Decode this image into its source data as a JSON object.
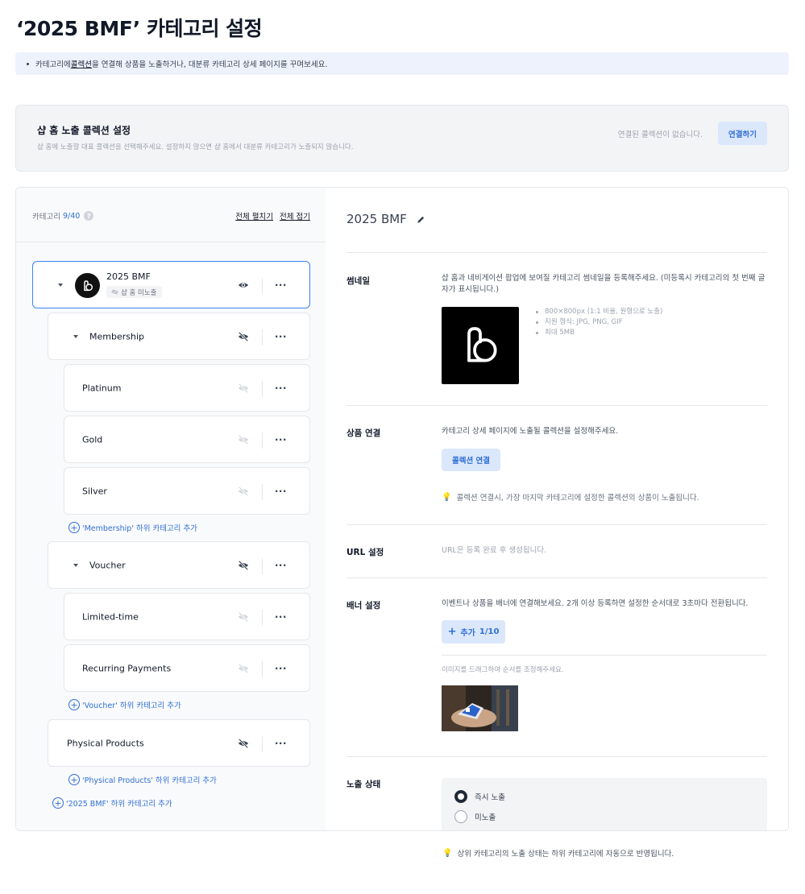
{
  "page": {
    "title": "‘2025 BMF’ 카테고리 설정"
  },
  "notice": {
    "text_before": "카테고리에 ",
    "link": "콜렉션",
    "text_after": "을 연결해 상품을 노출하거나, 대분류 카테고리 상세 페이지를 꾸며보세요."
  },
  "shop_home": {
    "title": "샵 홈 노출 콜렉션 설정",
    "description": "샵 홈에 노출할 대표 콜렉션을 선택해주세요. 설정하지 않으면 샵 홈에서 대분류 카테고리가 노출되지 않습니다.",
    "status": "연결된 콜렉션이 없습니다.",
    "connect_button": "연결하기"
  },
  "category_tree": {
    "label": "카테고리",
    "count": "9/40",
    "expand_all": "전체 펼치기",
    "collapse_all": "전체 접기",
    "root": {
      "name": "2025 BMF",
      "badge": "샵 홈 미노출"
    },
    "membership": {
      "name": "Membership",
      "children": [
        "Platinum",
        "Gold",
        "Silver"
      ],
      "add_label": "'Membership' 하위 카테고리 추가"
    },
    "voucher": {
      "name": "Voucher",
      "children": [
        "Limited-time",
        "Recurring Payments"
      ],
      "add_label": "'Voucher' 하위 카테고리 추가"
    },
    "physical": {
      "name": "Physical Products",
      "add_label": "'Physical Products' 하위 카테고리 추가"
    },
    "root_add_label": "'2025 BMF' 하위 카테고리 추가"
  },
  "detail": {
    "title": "2025 BMF",
    "thumbnail": {
      "label": "썸네일",
      "description_line1": "샵 홈과 네비게이션 팝업에 보여질 카테고리 썸네일을 등록해주세요. (미등록시 카테고리의 첫 번째 글",
      "description_line2": "자가 표시됩니다.)",
      "specs": [
        "800×800px (1:1 비율, 원형으로 노출)",
        "지원 형식: JPG, PNG, GIF",
        "최대 5MB"
      ]
    },
    "product_link": {
      "label": "상품 연결",
      "description": "카테고리 상세 페이지에 노출될 콜렉션을 설정해주세요.",
      "button": "콜렉션 연결",
      "hint": "콜렉션 연결시, 가장 마지막 카테고리에 설정한 콜렉션의 상품이 노출됩니다."
    },
    "url": {
      "label": "URL 설정",
      "text": "URL은 등록 완료 후 생성됩니다."
    },
    "banner": {
      "label": "배너 설정",
      "description": "이벤트나 상품을 배너에 연결해보세요. 2개 이상 등록하면 설정한 순서대로 3초마다 전환됩니다.",
      "add_button": "추가",
      "add_count": "1/10",
      "drag_hint": "이미지를 드래그하여 순서를 조정해주세요."
    },
    "exposure": {
      "label": "노출 상태",
      "options": [
        "즉시 노출",
        "미노출"
      ],
      "selected": "즉시 노출",
      "hint": "상위 카테고리의 노출 상태는 하위 카테고리에 자동으로 반영됩니다."
    }
  }
}
